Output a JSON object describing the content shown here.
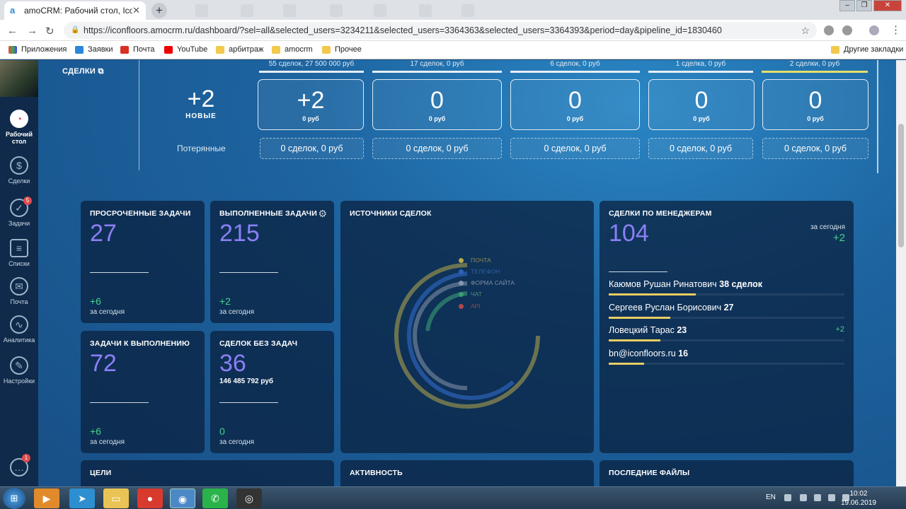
{
  "browser": {
    "tab_title": "amoCRM: Рабочий стол, Icon",
    "url": "https://iconfloors.amocrm.ru/dashboard/?sel=all&selected_users=3234211&selected_users=3364363&selected_users=3364393&period=day&pipeline_id=1830460",
    "bookmarks": [
      "Приложения",
      "Заявки",
      "Почта",
      "YouTube",
      "арбитраж",
      "amocrm",
      "Прочее"
    ],
    "other_bookmarks": "Другие закладки"
  },
  "sidebar": {
    "items": [
      {
        "label": "Рабочий стол",
        "icon": "dashboard-icon"
      },
      {
        "label": "Сделки",
        "icon": "dollar-icon"
      },
      {
        "label": "Задачи",
        "icon": "check-icon",
        "badge": "5"
      },
      {
        "label": "Списки",
        "icon": "list-icon"
      },
      {
        "label": "Почта",
        "icon": "mail-icon"
      },
      {
        "label": "Аналитика",
        "icon": "analytics-icon"
      },
      {
        "label": "Настройки",
        "icon": "wrench-icon"
      }
    ],
    "chat_badge": "1"
  },
  "pipeline": {
    "link": "СДЕЛКИ",
    "new_count": "+2",
    "new_label": "НОВЫЕ",
    "lost_label": "Потерянные",
    "stages": [
      {
        "head": "55 сделок, 27 500 000 руб",
        "value": "+2",
        "sub": "0 руб",
        "lost": "0 сделок, 0 руб",
        "color": "#e8eef4"
      },
      {
        "head": "17 сделок, 0 руб",
        "value": "0",
        "sub": "0 руб",
        "lost": "0 сделок, 0 руб",
        "color": "#e8eef4"
      },
      {
        "head": "6 сделок, 0 руб",
        "value": "0",
        "sub": "0 руб",
        "lost": "0 сделок, 0 руб",
        "color": "#e8eef4"
      },
      {
        "head": "1 сделка, 0 руб",
        "value": "0",
        "sub": "0 руб",
        "lost": "0 сделок, 0 руб",
        "color": "#e8eef4"
      },
      {
        "head": "2 сделки, 0 руб",
        "value": "0",
        "sub": "0 руб",
        "lost": "0 сделок, 0 руб",
        "color": "#e6df6a"
      }
    ]
  },
  "widgets": {
    "overdue": {
      "title": "ПРОСРОЧЕННЫЕ ЗАДАЧИ",
      "value": "27",
      "inc": "+6",
      "today": "за сегодня"
    },
    "done": {
      "title": "ВЫПОЛНЕННЫЕ ЗАДАЧИ",
      "value": "215",
      "inc": "+2",
      "today": "за сегодня"
    },
    "todo": {
      "title": "ЗАДАЧИ К ВЫПОЛНЕНИЮ",
      "value": "72",
      "inc": "+6",
      "today": "за сегодня"
    },
    "notasks": {
      "title": "СДЕЛОК БЕЗ ЗАДАЧ",
      "value": "36",
      "amount": "146 485 792 руб",
      "inc": "0",
      "today": "за сегодня"
    },
    "sources": {
      "title": "ИСТОЧНИКИ СДЕЛОК",
      "legend": [
        {
          "label": "ПОЧТА",
          "color": "#b8a94a"
        },
        {
          "label": "ТЕЛЕФОН",
          "color": "#2c63b8"
        },
        {
          "label": "ФОРМА САЙТА",
          "color": "#8796ad"
        },
        {
          "label": "ЧАТ",
          "color": "#3b9d74"
        },
        {
          "label": "API",
          "color": "#b04a4a"
        }
      ]
    },
    "managers": {
      "title": "СДЕЛКИ ПО МЕНЕДЖЕРАМ",
      "value": "104",
      "today": "за сегодня",
      "inc": "+2",
      "rows": [
        {
          "name": "Каюмов Рушан Ринатович",
          "count": "38 сделок",
          "fill": 0.37,
          "inc": ""
        },
        {
          "name": "Сергеев Руслан Борисович",
          "count": "27",
          "fill": 0.26,
          "inc": ""
        },
        {
          "name": "Ловецкий Тарас",
          "count": "23",
          "fill": 0.22,
          "inc": "+2"
        },
        {
          "name": "bn@iconfloors.ru",
          "count": "16",
          "fill": 0.15,
          "inc": ""
        }
      ]
    },
    "goals": {
      "title": "ЦЕЛИ"
    },
    "activity": {
      "title": "АКТИВНОСТЬ"
    },
    "files": {
      "title": "ПОСЛЕДНИЕ ФАЙЛЫ"
    }
  },
  "taskbar": {
    "lang": "EN",
    "time": "10:02",
    "date": "19.06.2019"
  }
}
